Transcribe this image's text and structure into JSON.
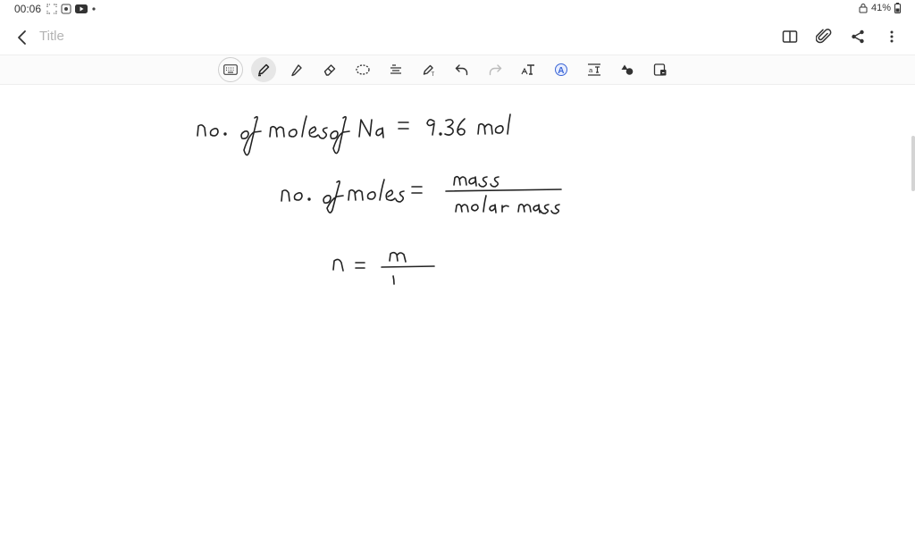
{
  "status": {
    "time": "00:06",
    "battery": "41%"
  },
  "title_bar": {
    "title": "Title"
  },
  "colors": {
    "ink": "#222222",
    "title_placeholder": "#b3b3b3",
    "accent_text_tool": "#3b66d6"
  },
  "toolbar": {
    "tools": [
      "keyboard-icon",
      "pen-icon",
      "highlighter-icon",
      "eraser-icon",
      "lasso-icon",
      "text-align-icon",
      "pen-settings-icon",
      "undo-icon",
      "redo-icon",
      "text-tool-icon",
      "style-icon",
      "text-box-icon",
      "shapes-icon",
      "image-insert-icon"
    ]
  }
}
